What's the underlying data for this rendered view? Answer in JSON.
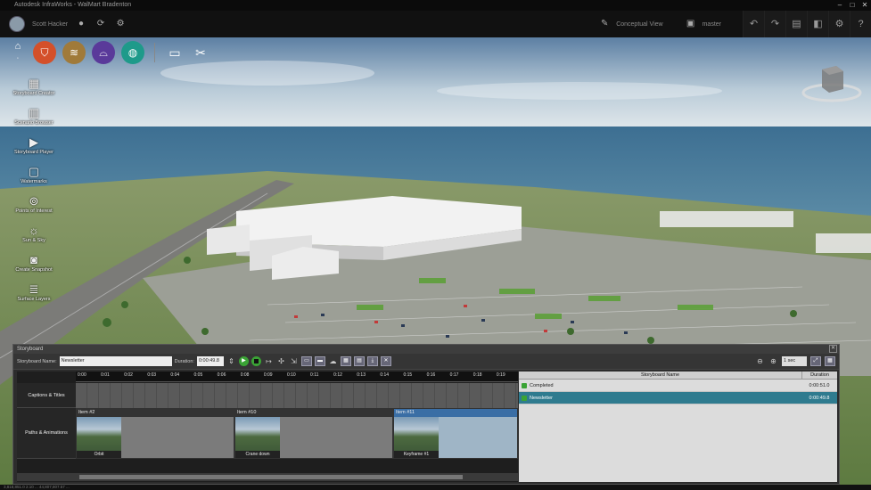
{
  "titlebar": {
    "title": "Autodesk InfraWorks - WalMart Bradenton"
  },
  "topbar": {
    "user_name": "Scott Hacker",
    "view_mode": "Conceptual View",
    "proposal": "master"
  },
  "sidebar": {
    "items": [
      {
        "label": "Storyboard Creator",
        "icon": "storyboard-icon"
      },
      {
        "label": "Scenario Browser",
        "icon": "scenario-icon"
      },
      {
        "label": "Storyboard Player",
        "icon": "player-icon"
      },
      {
        "label": "Watermarks",
        "icon": "watermark-icon"
      },
      {
        "label": "Points of Interest",
        "icon": "poi-icon"
      },
      {
        "label": "Sun & Sky",
        "icon": "sun-icon"
      },
      {
        "label": "Create Snapshot",
        "icon": "camera-icon"
      },
      {
        "label": "Surface Layers",
        "icon": "layers-icon"
      }
    ]
  },
  "colors": {
    "tool_orange": "#d4502a",
    "tool_tan": "#a07a3a",
    "tool_purple": "#5a3a9a",
    "tool_teal": "#1e9a8a",
    "accent_teal": "#2f7b8f"
  },
  "storyboard": {
    "panel_title": "Storyboard",
    "name_label": "Storyboard Name:",
    "name_value": "Newsletter",
    "duration_label": "Duration:",
    "duration_value": "0:00:49.8",
    "step_value": "1 sec",
    "ticks": [
      "0:00",
      "0:01",
      "0:02",
      "0:03",
      "0:04",
      "0:05",
      "0:06",
      "0:08",
      "0:09",
      "0:10",
      "0:11",
      "0:12",
      "0:13",
      "0:14",
      "0:15",
      "0:16",
      "0:17",
      "0:18",
      "0:19"
    ],
    "tracks": [
      {
        "label": "Captions & Titles"
      },
      {
        "label": "Paths & Animations"
      }
    ],
    "clips": [
      {
        "title": "Item #2",
        "caption": "Orbit"
      },
      {
        "title": "Item #10",
        "caption": "Crane down"
      },
      {
        "title": "Item #11",
        "caption": "Keyframe #1"
      }
    ],
    "list_headers": {
      "name": "Storyboard Name",
      "duration": "Duration"
    },
    "list": [
      {
        "name": "Completed",
        "duration": "0:00:51.0"
      },
      {
        "name": "Newsletter",
        "duration": "0:00:49.8"
      }
    ]
  },
  "status": {
    "text": "3,818,851.0 2.10 ... 44,807,807.57 ..."
  }
}
